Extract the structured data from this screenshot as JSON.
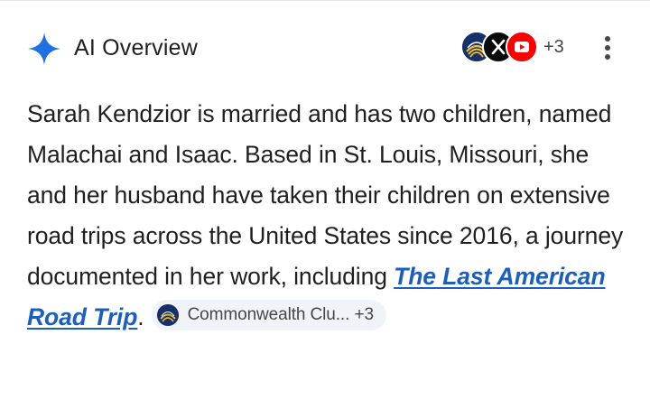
{
  "overview": {
    "title": "AI Overview",
    "more_sources_count": "+3",
    "sources": [
      {
        "icon": "commonwealth-club-logo-icon",
        "color": "#16306b"
      },
      {
        "icon": "x-logo-icon",
        "color": "#0a0a0a"
      },
      {
        "icon": "youtube-logo-icon",
        "color": "#ff0000"
      }
    ]
  },
  "answer": {
    "text_before_link": "Sarah Kendzior is married and has two children, named Malachai and Isaac. Based in St. Louis, Missouri, she and her husband have taken their children on extensive road trips across the United States since 2016, a journey documented in her work, including ",
    "link_text": "The Last American Road Trip",
    "text_after_link": ".",
    "citation": {
      "label": "Commonwealth Clu...",
      "count": "+3",
      "icon": "commonwealth-club-logo-icon"
    }
  },
  "colors": {
    "sparkle_blue": "#1f6fe5",
    "link_blue": "#1a5fbf",
    "chip_background": "#f0f4f9"
  }
}
